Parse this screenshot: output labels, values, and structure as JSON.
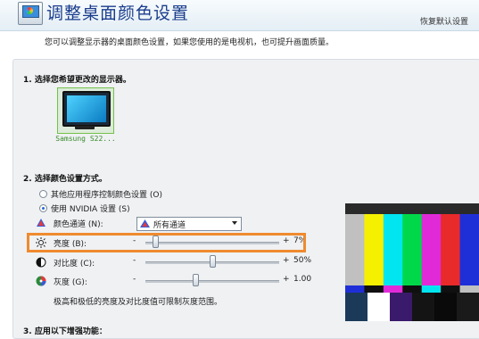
{
  "header": {
    "title": "调整桌面颜色设置",
    "restore_defaults": "恢复默认设置"
  },
  "description": "您可以调整显示器的桌面颜色设置，如果您使用的是电视机，也可提升画面质量。",
  "section1": {
    "heading": "1. 选择您希望更改的显示器。",
    "monitor_label": "Samsung S22..."
  },
  "section2": {
    "heading": "2. 选择颜色设置方式。",
    "radio_other": "其他应用程序控制颜色设置 (O)",
    "radio_nvidia": "使用 NVIDIA 设置 (S)",
    "channel_label": "颜色通道 (N):",
    "channel_value": "所有通道",
    "brightness_label": "亮度 (B):",
    "brightness_value": "7%",
    "contrast_label": "对比度 (C):",
    "contrast_value": "50%",
    "gamma_label": "灰度 (G):",
    "gamma_value": "1.00",
    "minus": "-",
    "plus": "+",
    "note": "极高和极低的亮度及对比度值可限制灰度范围。"
  },
  "section3": {
    "heading": "3. 应用以下增强功能："
  },
  "sliders": {
    "brightness_level": 0.07,
    "contrast_level": 0.5,
    "gamma_level": 0.37
  },
  "colors": {
    "highlight": "#ef8a2e",
    "title": "#1a3c8c",
    "radio_selected": "#2a6ad0"
  },
  "test_bars": {
    "top": [
      "#c0c0c0",
      "#f5f000",
      "#00e5f0",
      "#00d84a",
      "#e02ad8",
      "#e82a2a",
      "#1f2fd8"
    ],
    "middle": [
      "#1f2fd8",
      "#101010",
      "#e02ad8",
      "#101010",
      "#00e5f0",
      "#101010",
      "#c0c0c0"
    ],
    "bottom": [
      "#1b3a5a",
      "#ffffff",
      "#3a1a6a",
      "#141414",
      "#0a0a0a",
      "#1a1a1a"
    ]
  }
}
